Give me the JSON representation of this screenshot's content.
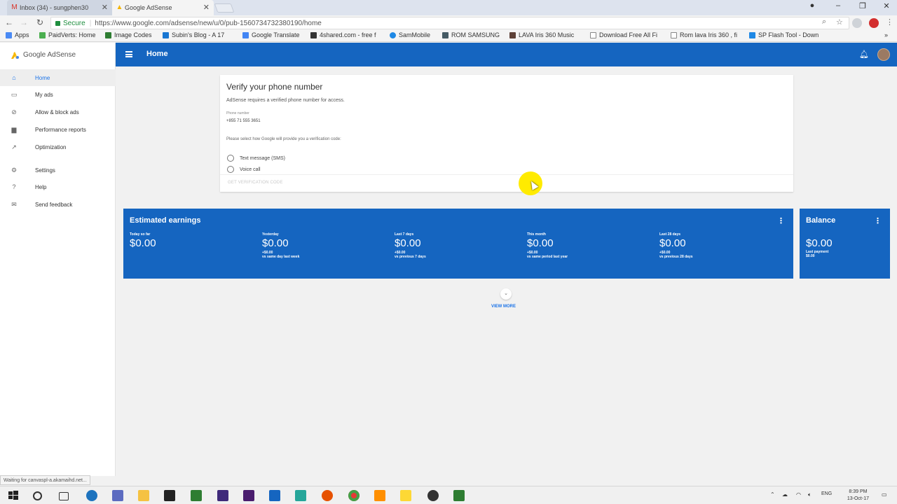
{
  "browser": {
    "tabs": [
      {
        "title": "Inbox (34) - sungphen30",
        "icon": "gmail-icon",
        "active": false
      },
      {
        "title": "Google AdSense",
        "icon": "adsense-icon",
        "active": true
      }
    ],
    "secure_label": "Secure",
    "url": "https://www.google.com/adsense/new/u/0/pub-1560734732380190/home",
    "bookmarks": [
      "Apps",
      "PaidVerts: Home",
      "Image Codes",
      "Subin's Blog - A 17",
      "Google Translate",
      "4shared.com - free f",
      "SamMobile",
      "ROM SAMSUNG",
      "LAVA Iris 360 Music",
      "Download Free All Fi",
      "Rom lava Iris 360 , fi",
      "SP Flash Tool - Down"
    ],
    "status_text": "Waiting for canvaspl-a.akamaihd.net..."
  },
  "app": {
    "brand": "Google AdSense",
    "header_title": "Home",
    "nav": [
      {
        "label": "Home",
        "icon": "home-icon",
        "active": true
      },
      {
        "label": "My ads",
        "icon": "ads-icon",
        "active": false
      },
      {
        "label": "Allow & block ads",
        "icon": "block-icon",
        "active": false
      },
      {
        "label": "Performance reports",
        "icon": "bar-chart-icon",
        "active": false
      },
      {
        "label": "Optimization",
        "icon": "trending-up-icon",
        "active": false
      },
      {
        "label": "Settings",
        "icon": "gear-icon",
        "active": false
      },
      {
        "label": "Help",
        "icon": "help-icon",
        "active": false
      },
      {
        "label": "Send feedback",
        "icon": "feedback-icon",
        "active": false
      }
    ]
  },
  "verify": {
    "title": "Verify your phone number",
    "description": "AdSense requires a verified phone number for access.",
    "phone_label": "Phone number",
    "phone_value": "+855 71 555 3651",
    "prompt": "Please select how Google will provide you a verification code:",
    "options": [
      "Text message (SMS)",
      "Voice call"
    ],
    "action": "GET VERIFICATION CODE"
  },
  "earnings": {
    "title": "Estimated earnings",
    "metrics": [
      {
        "label": "Today so far",
        "value": "$0.00",
        "change": "",
        "compare": ""
      },
      {
        "label": "Yesterday",
        "value": "$0.00",
        "change": "+$0.00",
        "compare": "vs same day last week"
      },
      {
        "label": "Last 7 days",
        "value": "$0.00",
        "change": "+$0.00",
        "compare": "vs previous 7 days"
      },
      {
        "label": "This month",
        "value": "$0.00",
        "change": "+$0.00",
        "compare": "vs same period last year"
      },
      {
        "label": "Last 28 days",
        "value": "$0.00",
        "change": "+$0.00",
        "compare": "vs previous 28 days"
      }
    ]
  },
  "balance": {
    "title": "Balance",
    "value": "$0.00",
    "last_payment_label": "Last payment",
    "last_payment_value": "$0.00"
  },
  "view_more": "VIEW MORE",
  "taskbar": {
    "language": "ENG",
    "time": "8:39 PM",
    "date": "13-Oct-17"
  },
  "colors": {
    "primary_blue": "#1565c0",
    "link_blue": "#1a73e8"
  }
}
